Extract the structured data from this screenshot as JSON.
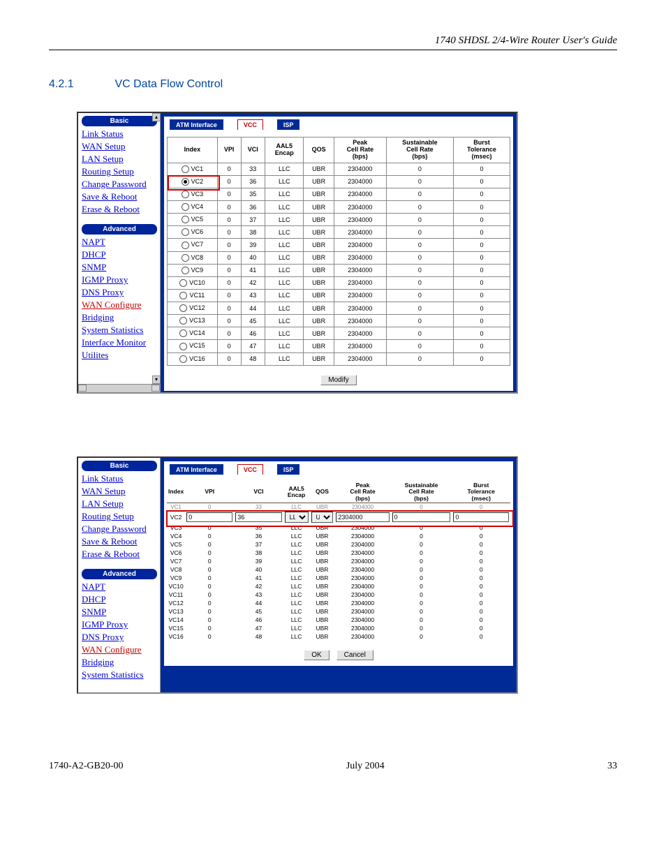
{
  "header": {
    "guide_title": "1740 SHDSL 2/4-Wire Router User's Guide"
  },
  "section": {
    "number": "4.2.1",
    "title": "VC Data Flow Control"
  },
  "sidebar": {
    "cat_basic": "Basic",
    "cat_advanced": "Advanced",
    "basic_links": [
      "Link Status",
      "WAN Setup",
      "LAN Setup",
      "Routing Setup",
      "Change Password",
      "Save & Reboot",
      "Erase & Reboot"
    ],
    "advanced_links": [
      "NAPT",
      "DHCP",
      "SNMP",
      "IGMP Proxy",
      "DNS Proxy",
      "WAN Configure",
      "Bridging",
      "System Statistics",
      "Interface Monitor",
      "Utilites"
    ]
  },
  "tabs": {
    "atm": "ATM Interface",
    "vcc": "VCC",
    "isp": "ISP"
  },
  "table1": {
    "headers": [
      "Index",
      "VPI",
      "VCI",
      "AAL5 Encap",
      "QOS",
      "Peak Cell Rate (bps)",
      "Sustainable Cell Rate (bps)",
      "Burst Tolerance (msec)"
    ],
    "rows": [
      {
        "idx": "VC1",
        "vpi": "0",
        "vci": "33",
        "encap": "LLC",
        "qos": "UBR",
        "peak": "2304000",
        "sus": "0",
        "burst": "0",
        "selected": false
      },
      {
        "idx": "VC2",
        "vpi": "0",
        "vci": "36",
        "encap": "LLC",
        "qos": "UBR",
        "peak": "2304000",
        "sus": "0",
        "burst": "0",
        "selected": true
      },
      {
        "idx": "VC3",
        "vpi": "0",
        "vci": "35",
        "encap": "LLC",
        "qos": "UBR",
        "peak": "2304000",
        "sus": "0",
        "burst": "0",
        "selected": false
      },
      {
        "idx": "VC4",
        "vpi": "0",
        "vci": "36",
        "encap": "LLC",
        "qos": "UBR",
        "peak": "2304000",
        "sus": "0",
        "burst": "0",
        "selected": false
      },
      {
        "idx": "VC5",
        "vpi": "0",
        "vci": "37",
        "encap": "LLC",
        "qos": "UBR",
        "peak": "2304000",
        "sus": "0",
        "burst": "0",
        "selected": false
      },
      {
        "idx": "VC6",
        "vpi": "0",
        "vci": "38",
        "encap": "LLC",
        "qos": "UBR",
        "peak": "2304000",
        "sus": "0",
        "burst": "0",
        "selected": false
      },
      {
        "idx": "VC7",
        "vpi": "0",
        "vci": "39",
        "encap": "LLC",
        "qos": "UBR",
        "peak": "2304000",
        "sus": "0",
        "burst": "0",
        "selected": false
      },
      {
        "idx": "VC8",
        "vpi": "0",
        "vci": "40",
        "encap": "LLC",
        "qos": "UBR",
        "peak": "2304000",
        "sus": "0",
        "burst": "0",
        "selected": false
      },
      {
        "idx": "VC9",
        "vpi": "0",
        "vci": "41",
        "encap": "LLC",
        "qos": "UBR",
        "peak": "2304000",
        "sus": "0",
        "burst": "0",
        "selected": false
      },
      {
        "idx": "VC10",
        "vpi": "0",
        "vci": "42",
        "encap": "LLC",
        "qos": "UBR",
        "peak": "2304000",
        "sus": "0",
        "burst": "0",
        "selected": false
      },
      {
        "idx": "VC11",
        "vpi": "0",
        "vci": "43",
        "encap": "LLC",
        "qos": "UBR",
        "peak": "2304000",
        "sus": "0",
        "burst": "0",
        "selected": false
      },
      {
        "idx": "VC12",
        "vpi": "0",
        "vci": "44",
        "encap": "LLC",
        "qos": "UBR",
        "peak": "2304000",
        "sus": "0",
        "burst": "0",
        "selected": false
      },
      {
        "idx": "VC13",
        "vpi": "0",
        "vci": "45",
        "encap": "LLC",
        "qos": "UBR",
        "peak": "2304000",
        "sus": "0",
        "burst": "0",
        "selected": false
      },
      {
        "idx": "VC14",
        "vpi": "0",
        "vci": "46",
        "encap": "LLC",
        "qos": "UBR",
        "peak": "2304000",
        "sus": "0",
        "burst": "0",
        "selected": false
      },
      {
        "idx": "VC15",
        "vpi": "0",
        "vci": "47",
        "encap": "LLC",
        "qos": "UBR",
        "peak": "2304000",
        "sus": "0",
        "burst": "0",
        "selected": false
      },
      {
        "idx": "VC16",
        "vpi": "0",
        "vci": "48",
        "encap": "LLC",
        "qos": "UBR",
        "peak": "2304000",
        "sus": "0",
        "burst": "0",
        "selected": false
      }
    ],
    "modify_btn": "Modify"
  },
  "table2": {
    "headers": [
      "Index",
      "VPI",
      "VCI",
      "AAL5 Encap",
      "QOS",
      "Peak Cell Rate (bps)",
      "Sustainable Cell Rate (bps)",
      "Burst Tolerance (msec)"
    ],
    "top_row": {
      "idx": "VC1",
      "vpi": "0",
      "vci": "33",
      "encap": "LLC",
      "qos": "UBR",
      "peak": "2304000",
      "sus": "0",
      "burst": "0"
    },
    "edit_row": {
      "idx": "VC2",
      "vpi": "0",
      "vci": "36",
      "encap_options": [
        "LLC"
      ],
      "encap_sel": "LLC",
      "qos_options": [
        "UBR"
      ],
      "qos_sel": "UBR",
      "peak": "2304000",
      "sus": "0",
      "burst": "0"
    },
    "rows": [
      {
        "idx": "VC3",
        "vpi": "0",
        "vci": "35",
        "encap": "LLC",
        "qos": "UBR",
        "peak": "2304000",
        "sus": "0",
        "burst": "0"
      },
      {
        "idx": "VC4",
        "vpi": "0",
        "vci": "36",
        "encap": "LLC",
        "qos": "UBR",
        "peak": "2304000",
        "sus": "0",
        "burst": "0"
      },
      {
        "idx": "VC5",
        "vpi": "0",
        "vci": "37",
        "encap": "LLC",
        "qos": "UBR",
        "peak": "2304000",
        "sus": "0",
        "burst": "0"
      },
      {
        "idx": "VC6",
        "vpi": "0",
        "vci": "38",
        "encap": "LLC",
        "qos": "UBR",
        "peak": "2304000",
        "sus": "0",
        "burst": "0"
      },
      {
        "idx": "VC7",
        "vpi": "0",
        "vci": "39",
        "encap": "LLC",
        "qos": "UBR",
        "peak": "2304000",
        "sus": "0",
        "burst": "0"
      },
      {
        "idx": "VC8",
        "vpi": "0",
        "vci": "40",
        "encap": "LLC",
        "qos": "UBR",
        "peak": "2304000",
        "sus": "0",
        "burst": "0"
      },
      {
        "idx": "VC9",
        "vpi": "0",
        "vci": "41",
        "encap": "LLC",
        "qos": "UBR",
        "peak": "2304000",
        "sus": "0",
        "burst": "0"
      },
      {
        "idx": "VC10",
        "vpi": "0",
        "vci": "42",
        "encap": "LLC",
        "qos": "UBR",
        "peak": "2304000",
        "sus": "0",
        "burst": "0"
      },
      {
        "idx": "VC11",
        "vpi": "0",
        "vci": "43",
        "encap": "LLC",
        "qos": "UBR",
        "peak": "2304000",
        "sus": "0",
        "burst": "0"
      },
      {
        "idx": "VC12",
        "vpi": "0",
        "vci": "44",
        "encap": "LLC",
        "qos": "UBR",
        "peak": "2304000",
        "sus": "0",
        "burst": "0"
      },
      {
        "idx": "VC13",
        "vpi": "0",
        "vci": "45",
        "encap": "LLC",
        "qos": "UBR",
        "peak": "2304000",
        "sus": "0",
        "burst": "0"
      },
      {
        "idx": "VC14",
        "vpi": "0",
        "vci": "46",
        "encap": "LLC",
        "qos": "UBR",
        "peak": "2304000",
        "sus": "0",
        "burst": "0"
      },
      {
        "idx": "VC15",
        "vpi": "0",
        "vci": "47",
        "encap": "LLC",
        "qos": "UBR",
        "peak": "2304000",
        "sus": "0",
        "burst": "0"
      },
      {
        "idx": "VC16",
        "vpi": "0",
        "vci": "48",
        "encap": "LLC",
        "qos": "UBR",
        "peak": "2304000",
        "sus": "0",
        "burst": "0"
      }
    ],
    "ok_btn": "OK",
    "cancel_btn": "Cancel"
  },
  "footer": {
    "left": "1740-A2-GB20-00",
    "center": "July 2004",
    "right": "33"
  },
  "sidebar2_advanced_visible": [
    "NAPT",
    "DHCP",
    "SNMP",
    "IGMP Proxy",
    "DNS Proxy",
    "WAN Configure",
    "Bridging",
    "System Statistics"
  ]
}
